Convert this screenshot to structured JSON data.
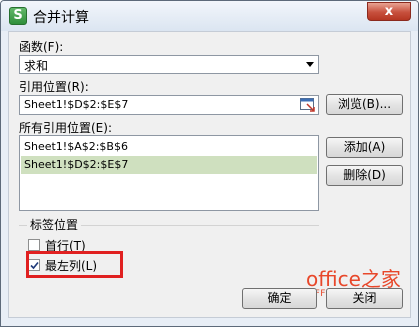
{
  "window": {
    "title": "合并计算",
    "app_icon_letter": "S",
    "close_symbol": "x"
  },
  "function": {
    "label": "函数(F):",
    "value": "求和"
  },
  "reference": {
    "label": "引用位置(R):",
    "value": "Sheet1!$D$2:$E$7",
    "browse_label": "浏览(B)..."
  },
  "all_references": {
    "label": "所有引用位置(E):",
    "items": [
      {
        "text": "Sheet1!$A$2:$B$6",
        "selected": false
      },
      {
        "text": "Sheet1!$D$2:$E$7",
        "selected": true
      }
    ],
    "add_label": "添加(A)",
    "delete_label": "删除(D)"
  },
  "label_position": {
    "title": "标签位置",
    "first_row": {
      "label": "首行(T)",
      "checked": false
    },
    "left_column": {
      "label": "最左列(L)",
      "checked": true
    }
  },
  "footer": {
    "ok_label": "确定",
    "close_label": "关闭"
  },
  "watermark": {
    "brand": "office之家",
    "url": "OFFICE.JB51.NET"
  },
  "colors": {
    "selection": "#cfe0bf",
    "highlight_box": "#e02020",
    "watermark": "#e8472a",
    "close_button": "#c7503d"
  }
}
